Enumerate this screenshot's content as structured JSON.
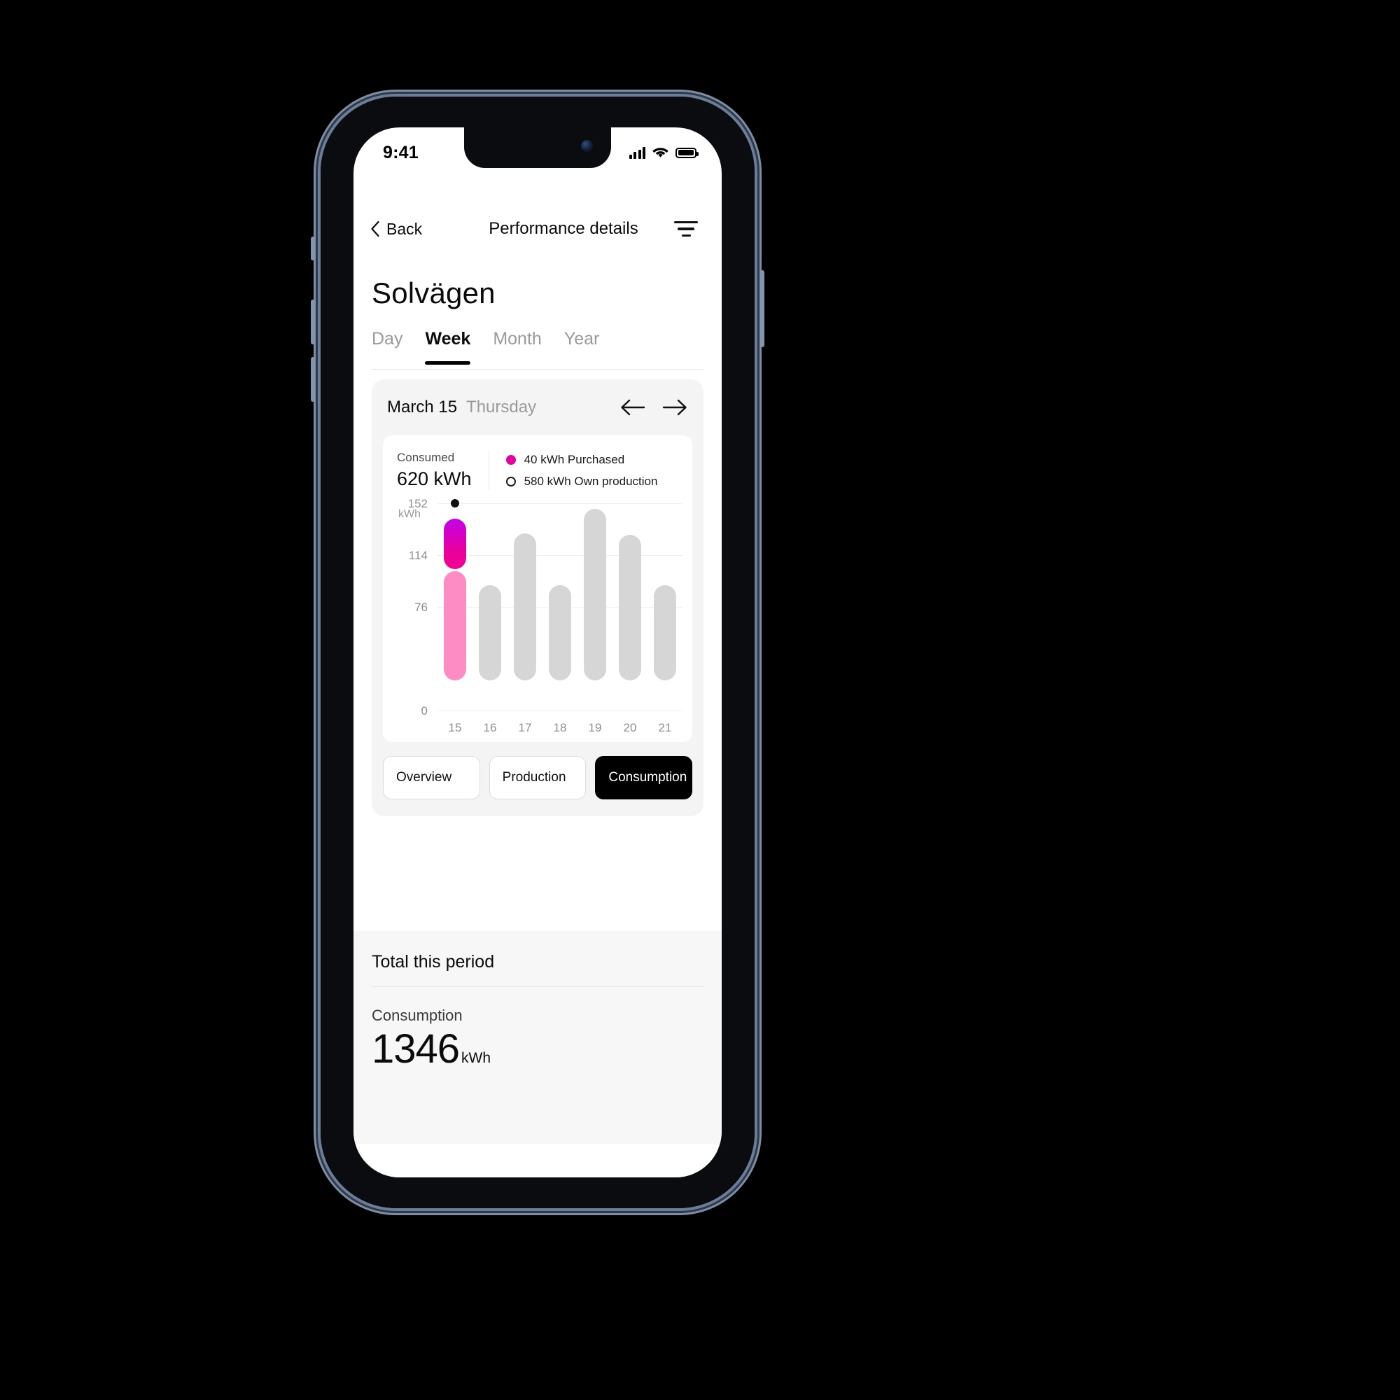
{
  "status_bar": {
    "time": "9:41",
    "icons": [
      "signal-bars-icon",
      "wifi-icon",
      "battery-icon"
    ]
  },
  "nav": {
    "back_label": "Back",
    "title": "Performance details",
    "back_icon": "chevron-left-icon",
    "filter_icon": "filter-icon"
  },
  "page": {
    "title": "Solvägen"
  },
  "tabs": [
    {
      "label": "Day",
      "active": false
    },
    {
      "label": "Week",
      "active": true
    },
    {
      "label": "Month",
      "active": false
    },
    {
      "label": "Year",
      "active": false
    }
  ],
  "date_selector": {
    "date": "March 15",
    "weekday": "Thursday",
    "prev_icon": "arrow-left-icon",
    "next_icon": "arrow-right-icon"
  },
  "summary": {
    "consumed_label": "Consumed",
    "consumed_value": "620 kWh",
    "legend": [
      {
        "marker": "filled-dot",
        "text": "40 kWh Purchased",
        "color": "#e6009e"
      },
      {
        "marker": "hollow-dot",
        "text": "580 kWh Own production",
        "color": "#1a1a1a"
      }
    ]
  },
  "mode_buttons": [
    {
      "label": "Overview",
      "active": false
    },
    {
      "label": "Production",
      "active": false
    },
    {
      "label": "Consumption",
      "active": true
    }
  ],
  "total": {
    "heading": "Total this period",
    "metric_label": "Consumption",
    "value": "1346",
    "unit": "kWh"
  },
  "colors": {
    "purchased_start": "#c300e8",
    "purchased_end": "#f50090",
    "own_production": "#fd8cc4",
    "inactive_bar": "#d6d6d6",
    "accent_black": "#000000",
    "panel_bg": "#f4f4f4",
    "muted_text": "#9a9a9a"
  },
  "chart_data": {
    "type": "bar",
    "title": "",
    "xlabel": "",
    "ylabel": "kWh",
    "unit_label": "kWh",
    "ylim": [
      0,
      152
    ],
    "yticks": [
      0,
      76,
      114,
      152
    ],
    "ytick_labels": [
      "0",
      "76",
      "114",
      "152"
    ],
    "grid": true,
    "grid_lines": [
      76,
      114,
      152
    ],
    "legend_position": "top",
    "categories": [
      "15",
      "16",
      "17",
      "18",
      "19",
      "20",
      "21"
    ],
    "selected_category": "15",
    "marker": {
      "category": "15",
      "value": 130,
      "style": "dotted-line-with-dot"
    },
    "series": [
      {
        "name": "Own production",
        "color": "#fd8cc4",
        "inactive_color": "#d6d6d6",
        "values": [
          80,
          70,
          108,
          70,
          126,
          107,
          70
        ]
      },
      {
        "name": "Purchased",
        "color": "#e6009e",
        "values": [
          37,
          0,
          0,
          0,
          0,
          0,
          0
        ]
      }
    ],
    "totals": [
      117,
      70,
      108,
      70,
      126,
      107,
      70
    ],
    "stacked": true,
    "highlighted_only_series_colors": true
  }
}
